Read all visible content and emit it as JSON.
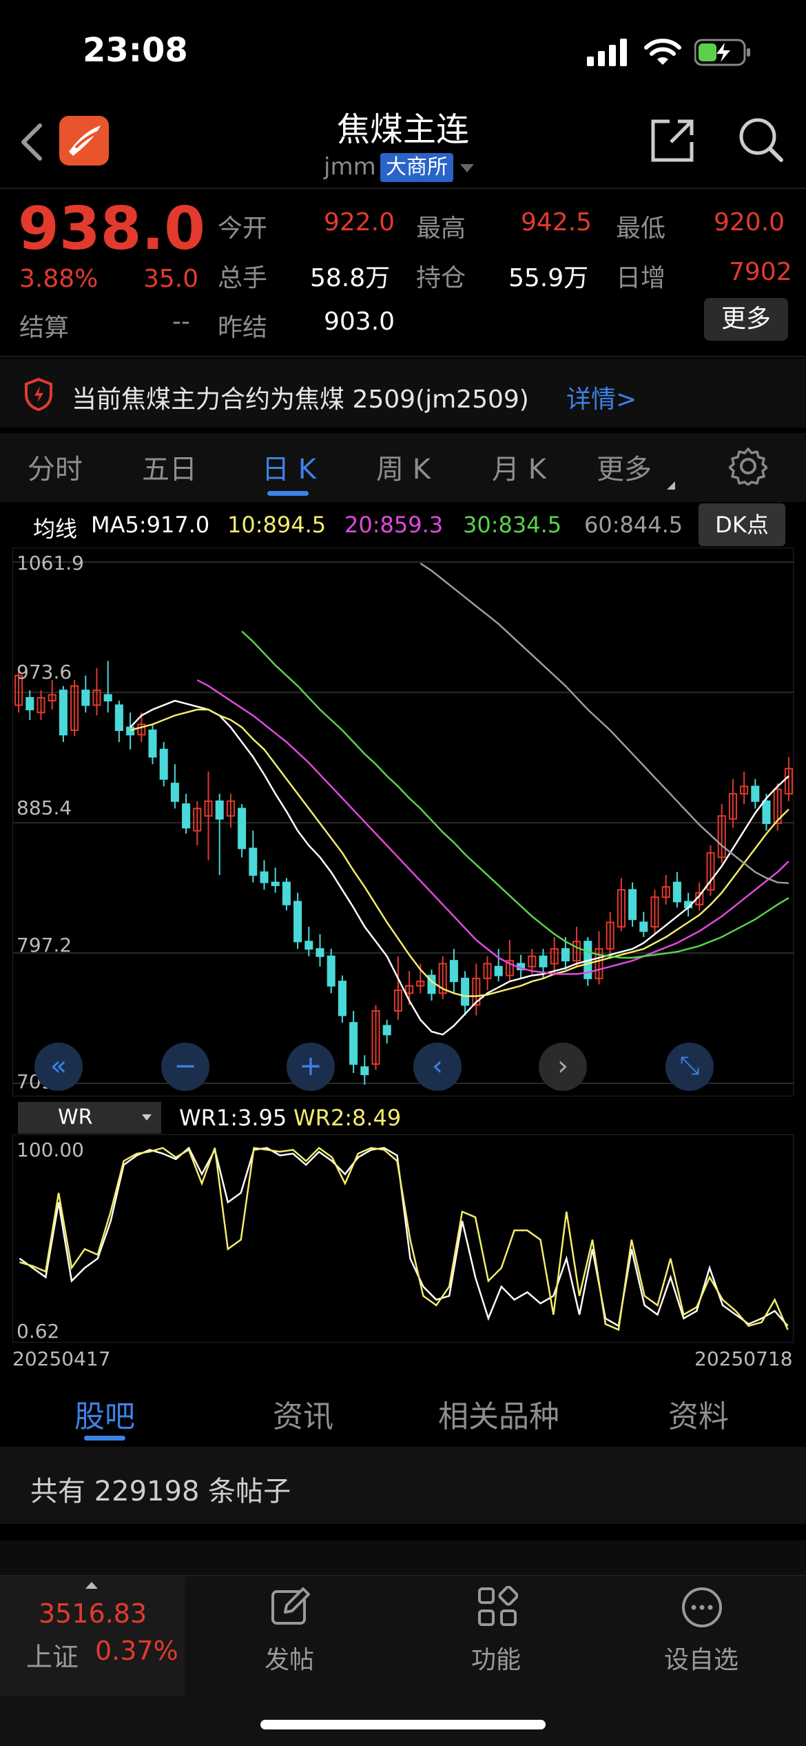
{
  "status_bar": {
    "time": "23:08"
  },
  "header": {
    "title": "焦煤主连",
    "code": "jmm",
    "exchange": "大商所"
  },
  "quote": {
    "price": "938.0",
    "change_pct": "3.88%",
    "change": "35.0",
    "settle_label": "结算",
    "settle_value": "--",
    "fields": [
      {
        "label": "今开",
        "value": "922.0"
      },
      {
        "label": "最高",
        "value": "942.5"
      },
      {
        "label": "最低",
        "value": "920.0"
      },
      {
        "label": "总手",
        "value": "58.8万"
      },
      {
        "label": "持仓",
        "value": "55.9万"
      },
      {
        "label": "日增",
        "value": "7902"
      },
      {
        "label": "昨结",
        "value": "903.0"
      }
    ],
    "more_button": "更多"
  },
  "notice": {
    "text": "当前焦煤主力合约为焦煤 2509(jm2509)",
    "link": "详情>"
  },
  "period_tabs": {
    "items": [
      "分时",
      "五日",
      "日 K",
      "周 K",
      "月 K",
      "更多"
    ],
    "active_index": 2
  },
  "ma_row": {
    "label": "均线",
    "ma5": "MA5:917.0",
    "ma10": "10:894.5",
    "ma20": "20:859.3",
    "ma30": "30:834.5",
    "ma60": "60:844.5",
    "dk_button": "DK点"
  },
  "chart_data": [
    {
      "type": "line",
      "title": "",
      "ylim": [
        709.0,
        1061.9
      ],
      "y_ticks": [
        "1061.9",
        "973.6",
        "885.4",
        "797.2",
        "709.0"
      ],
      "x_labels": [
        "20250417",
        "20250718"
      ],
      "candles": [
        {
          "o": 965,
          "c": 985,
          "h": 990,
          "l": 960
        },
        {
          "o": 970,
          "c": 962,
          "h": 975,
          "l": 955
        },
        {
          "o": 960,
          "c": 970,
          "h": 975,
          "l": 955
        },
        {
          "o": 968,
          "c": 972,
          "h": 982,
          "l": 962
        },
        {
          "o": 975,
          "c": 945,
          "h": 978,
          "l": 940
        },
        {
          "o": 948,
          "c": 978,
          "h": 982,
          "l": 944
        },
        {
          "o": 975,
          "c": 965,
          "h": 985,
          "l": 960
        },
        {
          "o": 965,
          "c": 975,
          "h": 990,
          "l": 958
        },
        {
          "o": 972,
          "c": 968,
          "h": 995,
          "l": 960
        },
        {
          "o": 965,
          "c": 948,
          "h": 968,
          "l": 940
        },
        {
          "o": 950,
          "c": 945,
          "h": 960,
          "l": 935
        },
        {
          "o": 945,
          "c": 952,
          "h": 960,
          "l": 940
        },
        {
          "o": 948,
          "c": 930,
          "h": 952,
          "l": 925
        },
        {
          "o": 935,
          "c": 915,
          "h": 940,
          "l": 910
        },
        {
          "o": 912,
          "c": 900,
          "h": 925,
          "l": 895
        },
        {
          "o": 898,
          "c": 882,
          "h": 905,
          "l": 878
        },
        {
          "o": 880,
          "c": 895,
          "h": 900,
          "l": 870
        },
        {
          "o": 890,
          "c": 900,
          "h": 920,
          "l": 860
        },
        {
          "o": 900,
          "c": 888,
          "h": 905,
          "l": 850
        },
        {
          "o": 890,
          "c": 900,
          "h": 905,
          "l": 882
        },
        {
          "o": 895,
          "c": 868,
          "h": 898,
          "l": 862
        },
        {
          "o": 868,
          "c": 850,
          "h": 880,
          "l": 845
        },
        {
          "o": 852,
          "c": 845,
          "h": 860,
          "l": 840
        },
        {
          "o": 845,
          "c": 843,
          "h": 855,
          "l": 838
        },
        {
          "o": 845,
          "c": 830,
          "h": 848,
          "l": 826
        },
        {
          "o": 832,
          "c": 805,
          "h": 838,
          "l": 800
        },
        {
          "o": 805,
          "c": 800,
          "h": 815,
          "l": 795
        },
        {
          "o": 800,
          "c": 795,
          "h": 810,
          "l": 788
        },
        {
          "o": 795,
          "c": 775,
          "h": 800,
          "l": 770
        },
        {
          "o": 778,
          "c": 755,
          "h": 782,
          "l": 750
        },
        {
          "o": 750,
          "c": 722,
          "h": 758,
          "l": 716
        },
        {
          "o": 720,
          "c": 715,
          "h": 728,
          "l": 708
        },
        {
          "o": 722,
          "c": 758,
          "h": 762,
          "l": 718
        },
        {
          "o": 748,
          "c": 742,
          "h": 752,
          "l": 736
        },
        {
          "o": 758,
          "c": 772,
          "h": 795,
          "l": 752
        },
        {
          "o": 770,
          "c": 775,
          "h": 785,
          "l": 762
        },
        {
          "o": 775,
          "c": 778,
          "h": 790,
          "l": 770
        },
        {
          "o": 782,
          "c": 770,
          "h": 786,
          "l": 765
        },
        {
          "o": 770,
          "c": 790,
          "h": 795,
          "l": 766
        },
        {
          "o": 792,
          "c": 778,
          "h": 800,
          "l": 770
        },
        {
          "o": 780,
          "c": 762,
          "h": 785,
          "l": 755
        },
        {
          "o": 762,
          "c": 780,
          "h": 790,
          "l": 755
        },
        {
          "o": 780,
          "c": 790,
          "h": 795,
          "l": 772
        },
        {
          "o": 788,
          "c": 782,
          "h": 800,
          "l": 778
        },
        {
          "o": 782,
          "c": 792,
          "h": 806,
          "l": 778
        },
        {
          "o": 790,
          "c": 786,
          "h": 796,
          "l": 780
        },
        {
          "o": 788,
          "c": 795,
          "h": 800,
          "l": 783
        },
        {
          "o": 795,
          "c": 788,
          "h": 800,
          "l": 780
        },
        {
          "o": 790,
          "c": 800,
          "h": 808,
          "l": 782
        },
        {
          "o": 800,
          "c": 792,
          "h": 808,
          "l": 786
        },
        {
          "o": 792,
          "c": 805,
          "h": 815,
          "l": 788
        },
        {
          "o": 805,
          "c": 780,
          "h": 808,
          "l": 775
        },
        {
          "o": 780,
          "c": 800,
          "h": 812,
          "l": 776
        },
        {
          "o": 800,
          "c": 818,
          "h": 825,
          "l": 795
        },
        {
          "o": 815,
          "c": 840,
          "h": 848,
          "l": 812
        },
        {
          "o": 840,
          "c": 820,
          "h": 845,
          "l": 815
        },
        {
          "o": 818,
          "c": 812,
          "h": 825,
          "l": 808
        },
        {
          "o": 815,
          "c": 835,
          "h": 840,
          "l": 810
        },
        {
          "o": 835,
          "c": 842,
          "h": 850,
          "l": 830
        },
        {
          "o": 845,
          "c": 832,
          "h": 852,
          "l": 828
        },
        {
          "o": 832,
          "c": 828,
          "h": 838,
          "l": 822
        },
        {
          "o": 830,
          "c": 838,
          "h": 845,
          "l": 826
        },
        {
          "o": 840,
          "c": 865,
          "h": 870,
          "l": 836
        },
        {
          "o": 862,
          "c": 890,
          "h": 898,
          "l": 858
        },
        {
          "o": 888,
          "c": 905,
          "h": 915,
          "l": 882
        },
        {
          "o": 905,
          "c": 910,
          "h": 920,
          "l": 898
        },
        {
          "o": 910,
          "c": 900,
          "h": 915,
          "l": 895
        },
        {
          "o": 900,
          "c": 885,
          "h": 905,
          "l": 880
        },
        {
          "o": 885,
          "c": 908,
          "h": 912,
          "l": 880
        },
        {
          "o": 905,
          "c": 922,
          "h": 930,
          "l": 900
        }
      ],
      "series": [
        {
          "name": "MA5",
          "color": "#ffffff",
          "values": [
            950,
            958,
            962,
            965,
            968,
            966,
            964,
            962,
            958,
            950,
            940,
            930,
            918,
            905,
            893,
            880,
            870,
            862,
            852,
            840,
            828,
            815,
            805,
            795,
            780,
            765,
            752,
            744,
            742,
            748,
            756,
            764,
            770,
            774,
            778,
            780,
            782,
            783,
            785,
            787,
            790,
            792,
            794,
            796,
            798,
            800,
            804,
            810,
            816,
            822,
            828,
            836,
            846,
            856,
            868,
            880,
            892,
            902,
            910,
            917
          ]
        },
        {
          "name": "MA10",
          "color": "#f5ed6b",
          "values": [
            948,
            950,
            952,
            955,
            958,
            960,
            962,
            962,
            958,
            955,
            950,
            942,
            935,
            925,
            915,
            905,
            895,
            885,
            875,
            865,
            853,
            842,
            830,
            818,
            807,
            796,
            786,
            778,
            773,
            770,
            768,
            768,
            769,
            771,
            773,
            775,
            778,
            780,
            783,
            785,
            788,
            790,
            792,
            794,
            796,
            798,
            800,
            804,
            808,
            813,
            818,
            823,
            830,
            838,
            848,
            858,
            868,
            878,
            887,
            894.5
          ]
        },
        {
          "name": "MA20",
          "color": "#e04ae0",
          "values": [
            982,
            978,
            973,
            968,
            963,
            958,
            952,
            946,
            940,
            933,
            926,
            918,
            910,
            902,
            894,
            886,
            878,
            870,
            862,
            854,
            846,
            838,
            830,
            822,
            814,
            806,
            800,
            794,
            790,
            787,
            785,
            784,
            783,
            783,
            783,
            784,
            786,
            788,
            790,
            792,
            795,
            798,
            801,
            804,
            808,
            812,
            817,
            822,
            828,
            834,
            840,
            846,
            852,
            859.3
          ]
        },
        {
          "name": "MA30",
          "color": "#59d44a",
          "values": [
            1015,
            1008,
            1000,
            992,
            985,
            978,
            970,
            962,
            955,
            948,
            940,
            932,
            925,
            917,
            910,
            902,
            895,
            887,
            879,
            872,
            864,
            857,
            850,
            843,
            836,
            829,
            822,
            816,
            810,
            805,
            801,
            798,
            796,
            795,
            794,
            794,
            795,
            796,
            797,
            798,
            800,
            802,
            805,
            808,
            812,
            816,
            820,
            825,
            830,
            834.5
          ]
        },
        {
          "name": "MA60",
          "color": "#9e9e9e",
          "values": [
            1061,
            1056,
            1050,
            1044,
            1038,
            1032,
            1026,
            1020,
            1013,
            1006,
            999,
            992,
            985,
            978,
            970,
            962,
            955,
            948,
            940,
            932,
            924,
            916,
            908,
            900,
            892,
            884,
            877,
            870,
            864,
            858,
            852,
            848,
            845,
            844.5
          ]
        }
      ]
    },
    {
      "type": "line",
      "title": "",
      "ylim": [
        0.62,
        100.0
      ],
      "y_ticks": [
        "100.00",
        "0.62"
      ],
      "series": [
        {
          "name": "WR1:3.95",
          "color": "#ffffff",
          "values": [
            40,
            35,
            30,
            70,
            28,
            35,
            40,
            60,
            90,
            95,
            98,
            96,
            93,
            99,
            85,
            98,
            70,
            75,
            98,
            99,
            95,
            96,
            90,
            97,
            92,
            85,
            94,
            98,
            99,
            95,
            40,
            25,
            18,
            20,
            60,
            30,
            8,
            25,
            18,
            22,
            16,
            20,
            40,
            10,
            45,
            8,
            4,
            45,
            15,
            10,
            30,
            8,
            12,
            35,
            15,
            10,
            5,
            8,
            12,
            4
          ]
        },
        {
          "name": "WR2:8.49",
          "color": "#f5ed6b",
          "values": [
            38,
            36,
            33,
            75,
            35,
            45,
            42,
            65,
            92,
            96,
            97,
            99,
            94,
            98,
            80,
            99,
            45,
            50,
            99,
            98,
            97,
            98,
            92,
            99,
            94,
            80,
            96,
            99,
            98,
            92,
            50,
            20,
            15,
            25,
            65,
            62,
            28,
            35,
            55,
            55,
            50,
            10,
            65,
            20,
            50,
            5,
            2,
            50,
            20,
            15,
            40,
            10,
            14,
            30,
            18,
            12,
            4,
            6,
            18,
            2
          ]
        }
      ]
    }
  ],
  "chart_controls": [
    "«",
    "−",
    "+",
    "‹",
    "›",
    "⤡"
  ],
  "wr_panel": {
    "selector": "WR",
    "wr1": "WR1:3.95",
    "wr2": "WR2:8.49"
  },
  "bottom_tabs": {
    "items": [
      "股吧",
      "资讯",
      "相关品种",
      "资料"
    ],
    "active_index": 0
  },
  "posts": {
    "text": "共有 229198 条帖子"
  },
  "footer": {
    "index_value": "3516.83",
    "index_name": "上证",
    "index_change": "0.37%",
    "actions": [
      {
        "icon": "compose-icon",
        "label": "发帖"
      },
      {
        "icon": "grid-icon",
        "label": "功能"
      },
      {
        "icon": "more-circle-icon",
        "label": "设自选"
      }
    ]
  }
}
